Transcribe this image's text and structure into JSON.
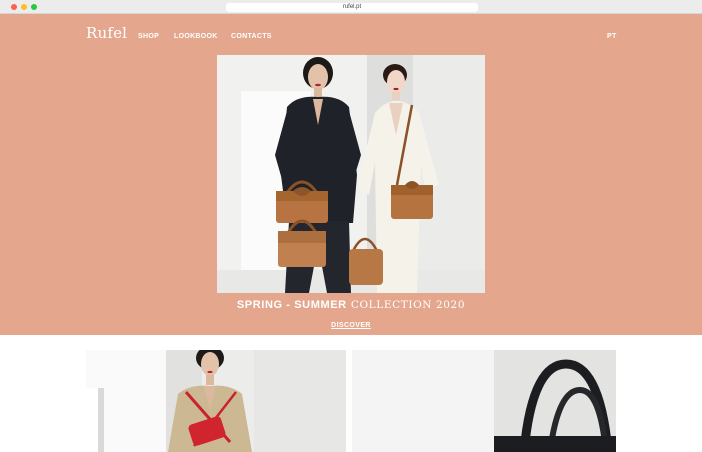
{
  "browser": {
    "url": "rufel.pt"
  },
  "header": {
    "logo": "Rufel",
    "nav": [
      "SHOP",
      "LOOKBOOK",
      "CONTACTS"
    ],
    "language": "PT"
  },
  "hero": {
    "collection_bold": "SPRING - SUMMER",
    "collection_light": "COLLECTION 2020",
    "discover_label": "DISCOVER",
    "background_color": "#e4a78e"
  },
  "icons": [
    "close-dot",
    "minimize-dot",
    "maximize-dot"
  ]
}
